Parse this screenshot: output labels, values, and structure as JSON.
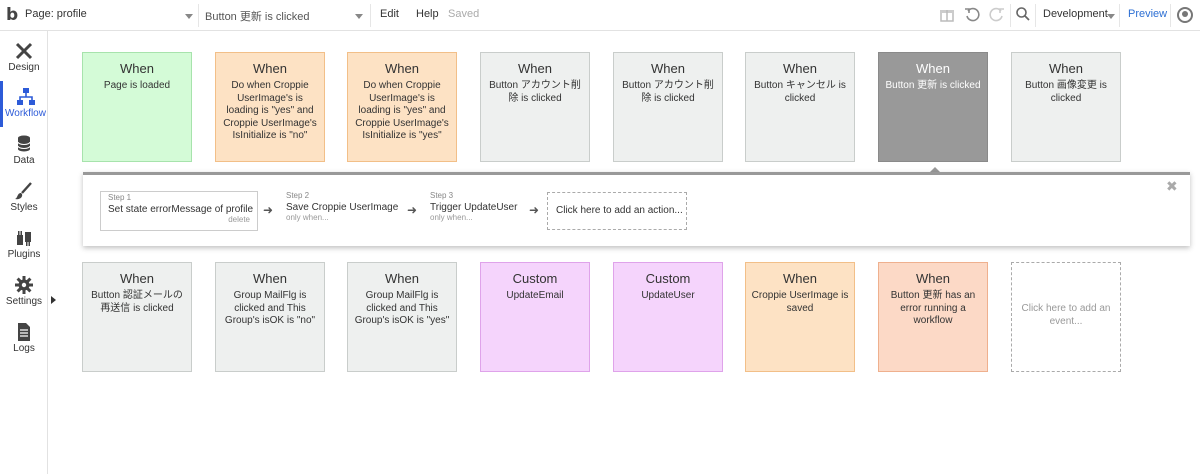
{
  "topbar": {
    "page_label": "Page: profile",
    "event_label": "Button 更新 is clicked",
    "edit": "Edit",
    "help": "Help",
    "saved": "Saved",
    "environment": "Development",
    "preview": "Preview",
    "icons": [
      "gift-icon",
      "undo-icon",
      "redo-icon",
      "search-icon",
      "user-icon"
    ]
  },
  "sidebar": {
    "items": [
      {
        "label": "Design",
        "icon": "design-icon"
      },
      {
        "label": "Workflow",
        "icon": "workflow-icon",
        "active": true
      },
      {
        "label": "Data",
        "icon": "data-icon"
      },
      {
        "label": "Styles",
        "icon": "styles-icon"
      },
      {
        "label": "Plugins",
        "icon": "plugins-icon"
      },
      {
        "label": "Settings",
        "icon": "settings-icon"
      },
      {
        "label": "Logs",
        "icon": "logs-icon"
      }
    ]
  },
  "events_row1": [
    {
      "title": "When",
      "desc": "Page is loaded",
      "color": "green"
    },
    {
      "title": "When",
      "desc": "Do when Croppie UserImage's is loading is \"yes\" and Croppie UserImage's IsInitialize is \"no\"",
      "color": "orange"
    },
    {
      "title": "When",
      "desc": "Do when Croppie UserImage's is loading is \"yes\" and Croppie UserImage's IsInitialize is \"yes\"",
      "color": "orange"
    },
    {
      "title": "When",
      "desc": "Button アカウント削除 is clicked",
      "color": "grey"
    },
    {
      "title": "When",
      "desc": "Button アカウント削除 is clicked",
      "color": "grey"
    },
    {
      "title": "When",
      "desc": "Button キャンセル is clicked",
      "color": "grey"
    },
    {
      "title": "When",
      "desc": "Button 更新 is clicked",
      "color": "dark",
      "selected": true
    },
    {
      "title": "When",
      "desc": "Button 画像変更 is clicked",
      "color": "grey"
    }
  ],
  "events_row2": [
    {
      "title": "When",
      "desc": "Button 認証メールの再送信 is clicked",
      "color": "grey"
    },
    {
      "title": "When",
      "desc": "Group MailFlg is clicked and This Group's isOK is \"no\"",
      "color": "grey"
    },
    {
      "title": "When",
      "desc": "Group MailFlg is clicked and This Group's isOK is \"yes\"",
      "color": "grey"
    },
    {
      "title": "Custom",
      "desc": "UpdateEmail",
      "color": "pink"
    },
    {
      "title": "Custom",
      "desc": "UpdateUser",
      "color": "pink"
    },
    {
      "title": "When",
      "desc": "Croppie UserImage is saved",
      "color": "orange"
    },
    {
      "title": "When",
      "desc": "Button 更新 has an error running a workflow",
      "color": "salmon"
    }
  ],
  "add_event_label": "Click here to add an event...",
  "steps": [
    {
      "num": "Step 1",
      "action": "Set state errorMessage of profile",
      "sub": "delete"
    },
    {
      "num": "Step 2",
      "action": "Save Croppie UserImage",
      "sub": "only when..."
    },
    {
      "num": "Step 3",
      "action": "Trigger UpdateUser",
      "sub": "only when..."
    }
  ],
  "add_action_label": "Click here to add an action...",
  "close_glyph": "✖",
  "colors": {
    "accent": "#2d5bd8",
    "green": "#d4fbd7",
    "orange": "#fde2c4",
    "grey": "#eef0ef",
    "dark": "#999999",
    "pink": "#f5d4fc",
    "salmon": "#fcd9c6"
  }
}
